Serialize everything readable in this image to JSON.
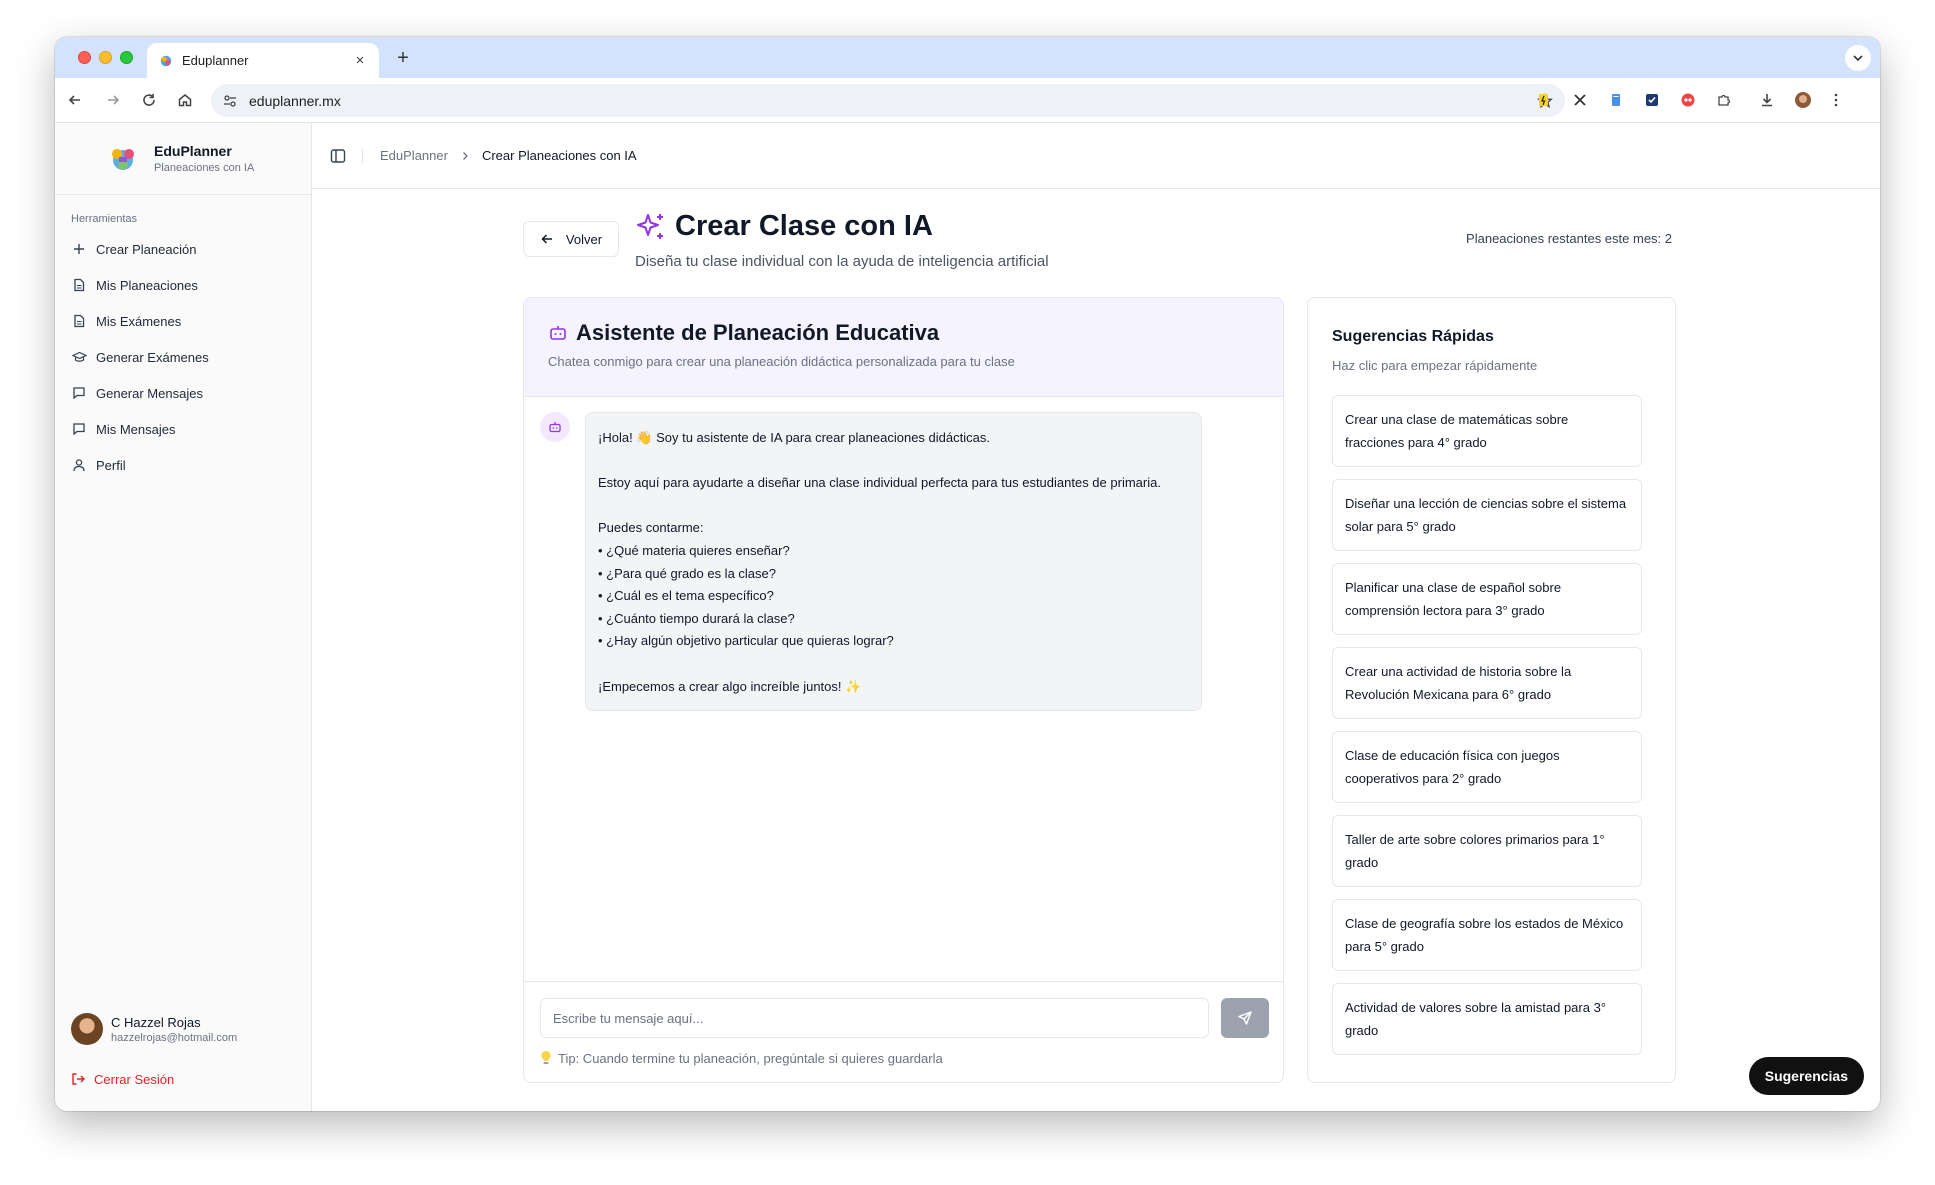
{
  "browser": {
    "tab_title": "Eduplanner",
    "tab_close": "×",
    "new_tab": "+",
    "url": "eduplanner.mx"
  },
  "sidebar": {
    "brand_name": "EduPlanner",
    "brand_sub": "Planeaciones con IA",
    "section_label": "Herramientas",
    "items": [
      {
        "label": "Crear Planeación",
        "icon": "plus-icon"
      },
      {
        "label": "Mis Planeaciones",
        "icon": "document-icon"
      },
      {
        "label": "Mis Exámenes",
        "icon": "document-icon"
      },
      {
        "label": "Generar Exámenes",
        "icon": "graduation-cap-icon"
      },
      {
        "label": "Generar Mensajes",
        "icon": "message-icon"
      },
      {
        "label": "Mis Mensajes",
        "icon": "message-icon"
      },
      {
        "label": "Perfil",
        "icon": "user-icon"
      }
    ],
    "user": {
      "name": "C Hazzel Rojas",
      "email": "hazzelrojas@hotmail.com"
    },
    "logout_label": "Cerrar Sesión"
  },
  "topbar": {
    "crumb_root": "EduPlanner",
    "crumb_current": "Crear Planeaciones con IA"
  },
  "header": {
    "back_label": "Volver",
    "title": "Crear Clase con IA",
    "subtitle": "Diseña tu clase individual con la ayuda de inteligencia artificial",
    "remaining": "Planeaciones restantes este mes: 2"
  },
  "chat": {
    "title": "Asistente de Planeación Educativa",
    "description": "Chatea conmigo para crear una planeación didáctica personalizada para tu clase",
    "message_lines": [
      "¡Hola! 👋 Soy tu asistente de IA para crear planeaciones didácticas.",
      "",
      "Estoy aquí para ayudarte a diseñar una clase individual perfecta para tus estudiantes de primaria.",
      "",
      "Puedes contarme:",
      "• ¿Qué materia quieres enseñar?",
      "• ¿Para qué grado es la clase?",
      "• ¿Cuál es el tema específico?",
      "• ¿Cuánto tiempo durará la clase?",
      "• ¿Hay algún objetivo particular que quieras lograr?",
      "",
      "¡Empecemos a crear algo increíble juntos! ✨"
    ],
    "input_placeholder": "Escribe tu mensaje aquí...",
    "input_value": "",
    "tip": "Tip: Cuando termine tu planeación, pregúntale si quieres guardarla"
  },
  "suggestions": {
    "title": "Sugerencias Rápidas",
    "subtitle": "Haz clic para empezar rápidamente",
    "items": [
      "Crear una clase de matemáticas sobre fracciones para 4° grado",
      "Diseñar una lección de ciencias sobre el sistema solar para 5° grado",
      "Planificar una clase de español sobre comprensión lectora para 3° grado",
      "Crear una actividad de historia sobre la Revolución Mexicana para 6° grado",
      "Clase de educación física con juegos cooperativos para 2° grado",
      "Taller de arte sobre colores primarios para 1° grado",
      "Clase de geografía sobre los estados de México para 5° grado",
      "Actividad de valores sobre la amistad para 3° grado"
    ]
  },
  "floating_button": "Sugerencias",
  "colors": {
    "accent_purple": "#9333ea",
    "logout_red": "#dc2626",
    "chat_header_bg": "#f4f3ff",
    "tabstrip_bg": "#d3e3fd"
  }
}
